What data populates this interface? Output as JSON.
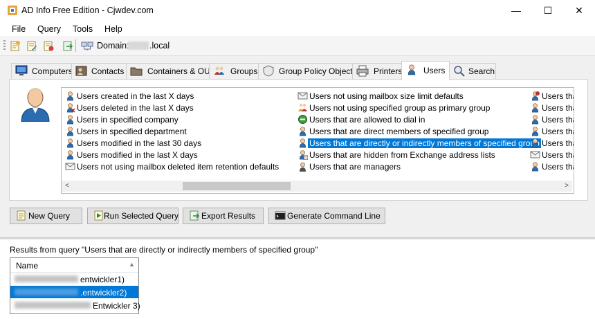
{
  "window": {
    "title": "AD Info Free Edition - Cjwdev.com",
    "minimize": "—",
    "maximize": "☐",
    "close": "✕"
  },
  "menu": [
    "File",
    "Query",
    "Tools",
    "Help"
  ],
  "toolbar": {
    "domain_label": "Domain:",
    "domain_value": ".local"
  },
  "tabs": [
    {
      "label": "Computers",
      "icon": "monitor-icon"
    },
    {
      "label": "Contacts",
      "icon": "contacts-icon"
    },
    {
      "label": "Containers & OUs",
      "icon": "folder-icon"
    },
    {
      "label": "Groups",
      "icon": "group-icon"
    },
    {
      "label": "Group Policy Objects",
      "icon": "policy-icon"
    },
    {
      "label": "Printers",
      "icon": "printer-icon"
    },
    {
      "label": "Users",
      "icon": "user-icon",
      "active": true
    },
    {
      "label": "Search",
      "icon": "search-icon"
    }
  ],
  "queries": {
    "column1": [
      "Users created in the last X days",
      "Users deleted in the last X days",
      "Users in specified company",
      "Users in specified department",
      "Users modified in the last 30 days",
      "Users modified in the last X days",
      "Users not using mailbox deleted item retention defaults"
    ],
    "column2": [
      "Users not using mailbox size limit defaults",
      "Users not using specified group as primary group",
      "Users that are allowed to dial in",
      "Users that are direct members of specified group",
      "Users that are directly or indirectly members of specified group",
      "Users that are hidden from Exchange address lists",
      "Users that are managers"
    ],
    "column3": [
      "Users that",
      "Users tha",
      "Users tha",
      "Users tha",
      "Users tha",
      "Users tha",
      "Users tha"
    ],
    "selected": "Users that are directly or indirectly members of specified group"
  },
  "scroll": {
    "left_arrow": "<",
    "right_arrow": ">"
  },
  "buttons": {
    "new_query": "New Query",
    "run_selected_query": "Run Selected Query",
    "export_results": "Export Results",
    "generate_command_line": "Generate Command Line"
  },
  "results": {
    "label": "Results from query \"Users that are directly or indirectly members of specified group\"",
    "column_header": "Name",
    "sort_indicator": "▲",
    "rows": [
      {
        "text": "entwickler1)",
        "selected": false
      },
      {
        "text": ".entwickler2)",
        "selected": true
      },
      {
        "text": "Entwickler 3)",
        "selected": false
      }
    ]
  },
  "colors": {
    "selection": "#0078d7",
    "user_icon": "#2b6cb0"
  }
}
